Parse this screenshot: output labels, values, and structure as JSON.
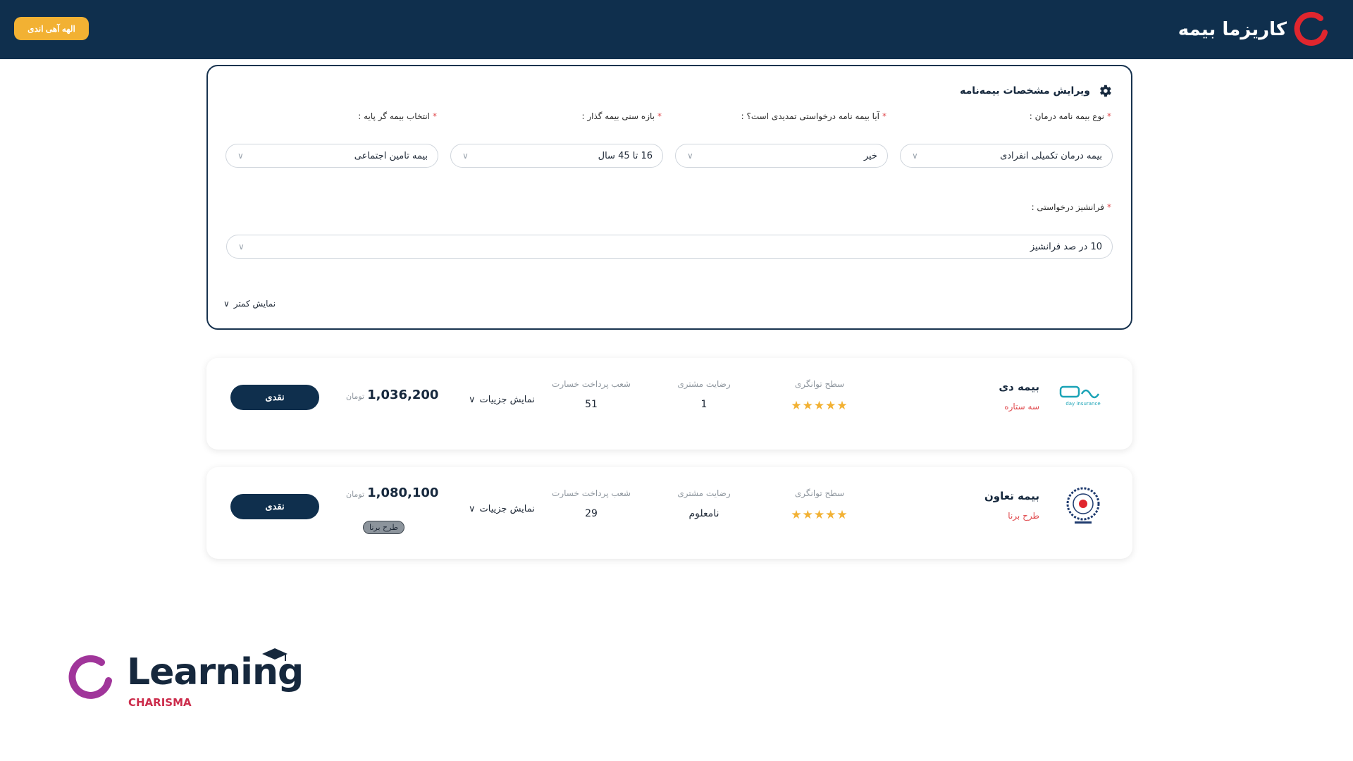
{
  "header": {
    "brand": "کاریزما بیمه",
    "user_button": "الهه آهی اندی"
  },
  "form": {
    "title": "ویرایش مشخصات بیمه‌نامه",
    "fields": [
      {
        "label": "نوع بیمه نامه درمان :",
        "value": "بیمه درمان تکمیلی انفرادی"
      },
      {
        "label": "آیا بیمه نامه درخواستی تمدیدی است؟ :",
        "value": "خیر"
      },
      {
        "label": "بازه سنی بیمه گذار :",
        "value": "16 تا 45 سال"
      },
      {
        "label": "انتخاب بیمه گر پایه :",
        "value": "بیمه تامین اجتماعی"
      }
    ],
    "franchise": {
      "label": "فرانشیز درخواستی :",
      "value": "10 در صد فرانشیز"
    },
    "toggle_label": "نمایش کمتر"
  },
  "labels": {
    "solvency": "سطح توانگری",
    "satisfaction": "رضایت مشتری",
    "branches": "شعب پرداخت خسارت",
    "details": "نمایش جزییات",
    "currency": "تومان",
    "buy": "نقدی"
  },
  "offers": [
    {
      "company": "بیمه دی",
      "plan": "سه ستاره",
      "logo_text": "بیمه دی",
      "logo_sub": "day insurance",
      "stars": 5,
      "stars_text": "★★★★★",
      "satisfaction": "1",
      "branches": "51",
      "price": "1,036,200",
      "badge": ""
    },
    {
      "company": "بیمه تعاون",
      "plan": "طرح برنا",
      "logo_text": "",
      "logo_sub": "",
      "stars": 5,
      "stars_text": "★★★★★",
      "satisfaction": "نامعلوم",
      "branches": "29",
      "price": "1,080,100",
      "badge": "طرح برنا"
    }
  ],
  "watermark": {
    "word": "Learning",
    "sub": "CHARISMA"
  },
  "colors": {
    "header_bg": "#0f2f4d",
    "accent": "#f2b133",
    "brand_red": "#e0262e",
    "required": "#e0494d",
    "learning_purple": "#a0359a"
  }
}
